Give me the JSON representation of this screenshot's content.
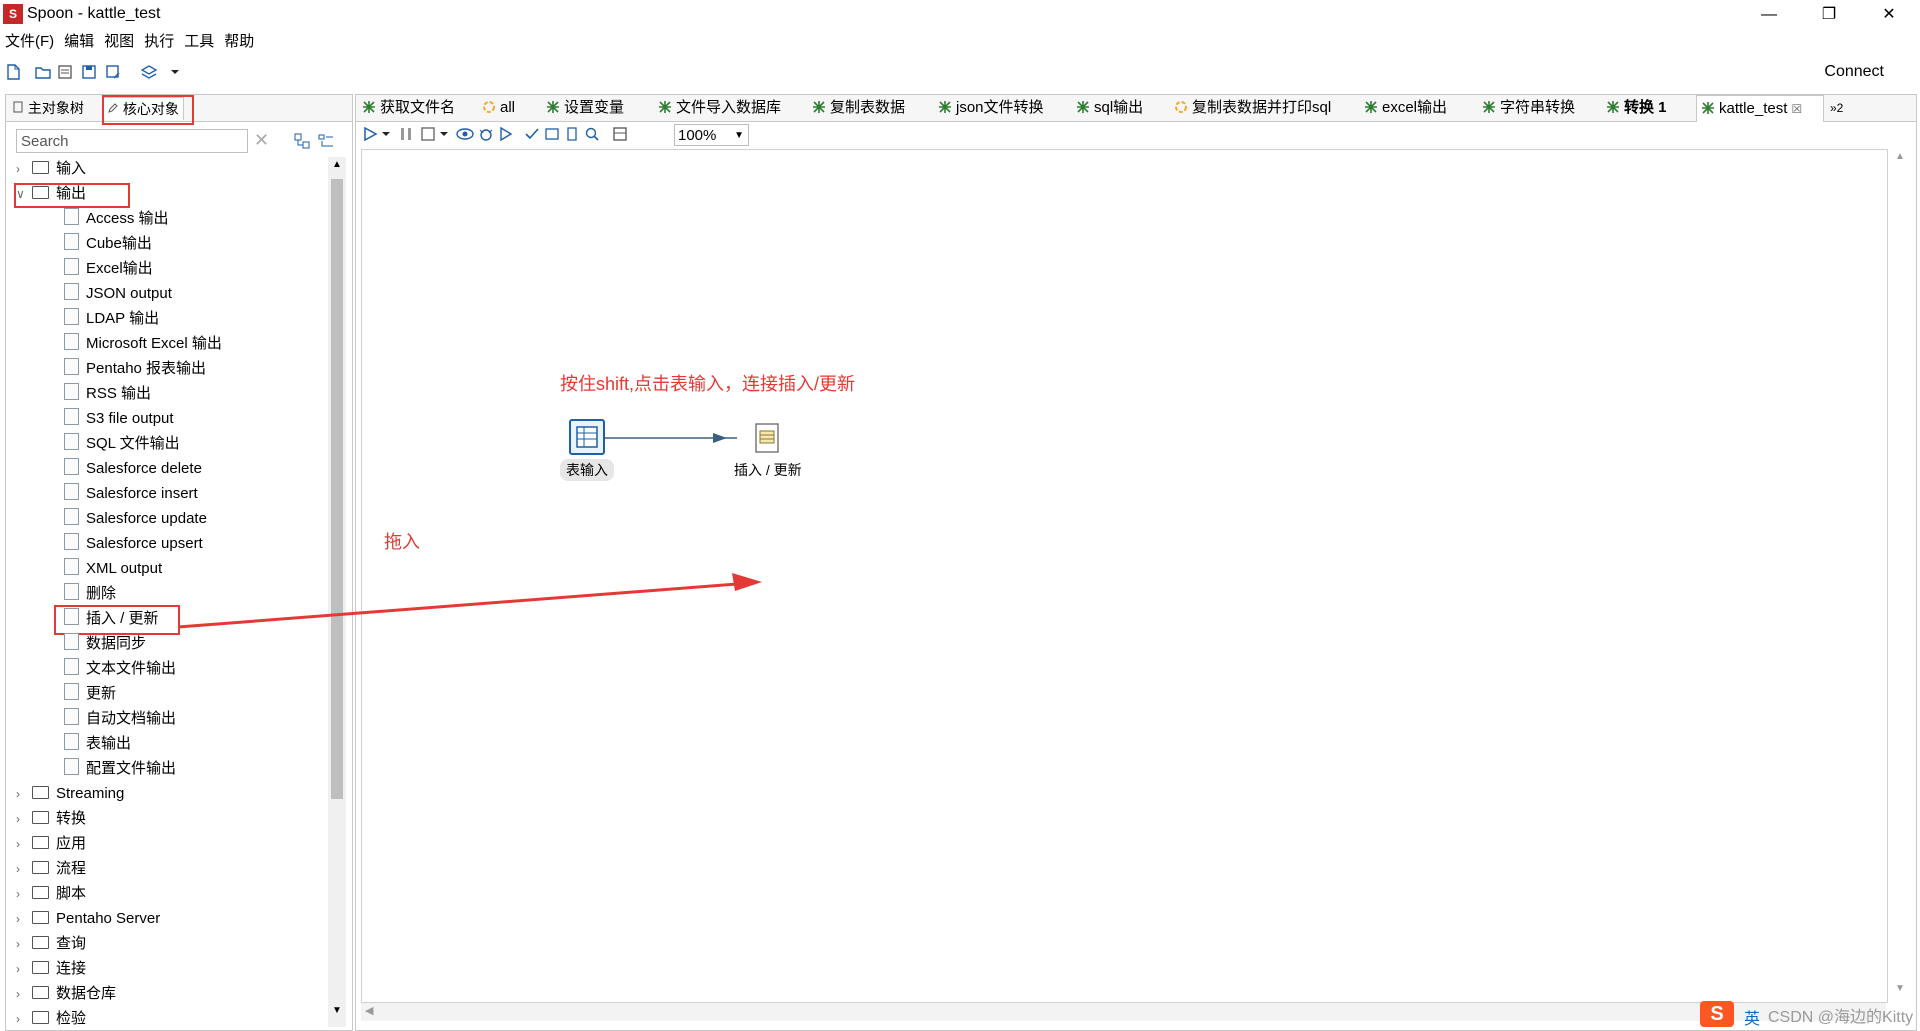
{
  "window": {
    "title": "Spoon - kattle_test",
    "logo_text": "S",
    "btn_min": "—",
    "btn_max": "❐",
    "btn_close": "✕"
  },
  "menu": [
    "文件(F)",
    "编辑",
    "视图",
    "执行",
    "工具",
    "帮助"
  ],
  "toolbar": {
    "connect": "Connect"
  },
  "left_tabs": {
    "main_tree": "主对象树",
    "core_objects": "核心对象"
  },
  "search": {
    "placeholder": "Search"
  },
  "tree": {
    "top_folders": [
      "输入",
      "输出"
    ],
    "output_items": [
      "Access 输出",
      "Cube输出",
      "Excel输出",
      "JSON output",
      "LDAP 输出",
      "Microsoft Excel 输出",
      "Pentaho 报表输出",
      "RSS 输出",
      "S3 file output",
      "SQL 文件输出",
      "Salesforce delete",
      "Salesforce insert",
      "Salesforce update",
      "Salesforce upsert",
      "XML output",
      "删除",
      "插入 / 更新",
      "数据同步",
      "文本文件输出",
      "更新",
      "自动文档输出",
      "表输出",
      "配置文件输出"
    ],
    "bottom_folders": [
      "Streaming",
      "转换",
      "应用",
      "流程",
      "脚本",
      "Pentaho Server",
      "查询",
      "连接",
      "数据仓库",
      "检验"
    ]
  },
  "doc_tabs": [
    {
      "label": "获取文件名",
      "kind": "trans"
    },
    {
      "label": "all",
      "kind": "job"
    },
    {
      "label": "设置变量",
      "kind": "trans"
    },
    {
      "label": "文件导入数据库",
      "kind": "trans"
    },
    {
      "label": "复制表数据",
      "kind": "trans"
    },
    {
      "label": "json文件转换",
      "kind": "trans"
    },
    {
      "label": "sql输出",
      "kind": "trans"
    },
    {
      "label": "复制表数据并打印sql",
      "kind": "job"
    },
    {
      "label": "excel输出",
      "kind": "trans"
    },
    {
      "label": "字符串转换",
      "kind": "trans"
    },
    {
      "label": "转换 1",
      "kind": "trans"
    },
    {
      "label": "kattle_test",
      "kind": "trans"
    }
  ],
  "tab_overflow": "»2",
  "tab_close": "☒",
  "zoom": "100%",
  "canvas": {
    "step1": "表输入",
    "step2": "插入 / 更新",
    "annotation_top": "按住shift,点击表输入，连接插入/更新",
    "annotation_drag": "拖入"
  },
  "watermark": "CSDN @海边的Kitty",
  "ime": "英",
  "colors": {
    "accent": "#e53935",
    "trans_icon": "#2e7d32",
    "job_icon": "#f9a825",
    "step_blue": "#1e5fa8"
  }
}
